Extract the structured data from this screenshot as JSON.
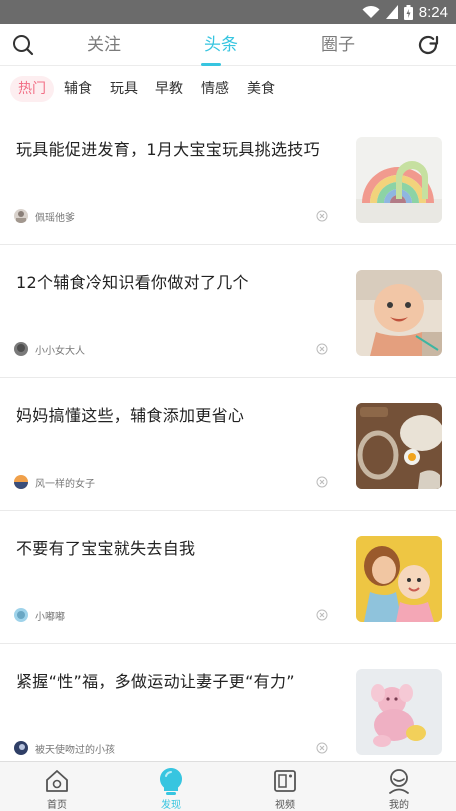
{
  "status": {
    "time": "8:24"
  },
  "header": {
    "tabs": [
      {
        "label": "关注"
      },
      {
        "label": "头条"
      },
      {
        "label": "圈子"
      }
    ],
    "active_tab": "头条",
    "accent": "#37c5e0"
  },
  "categories": [
    {
      "label": "热门"
    },
    {
      "label": "辅食"
    },
    {
      "label": "玩具"
    },
    {
      "label": "早教"
    },
    {
      "label": "情感"
    },
    {
      "label": "美食"
    }
  ],
  "active_category": "热门",
  "feed": [
    {
      "title": "玩具能促进发育，1月大宝宝玩具挑选技巧",
      "author": "佩瑶他爹"
    },
    {
      "title": "12个辅食冷知识看你做对了几个",
      "author": "小小女大人"
    },
    {
      "title": "妈妈搞懂这些，辅食添加更省心",
      "author": "风一样的女子"
    },
    {
      "title": "不要有了宝宝就失去自我",
      "author": "小嘟嘟"
    },
    {
      "title": "紧握“性”福，多做运动让妻子更“有力”",
      "author": "被天使吻过的小孩"
    }
  ],
  "bottom_nav": [
    {
      "label": "首页",
      "icon": "home-icon"
    },
    {
      "label": "发现",
      "icon": "bulb-icon"
    },
    {
      "label": "视频",
      "icon": "video-icon"
    },
    {
      "label": "我的",
      "icon": "user-icon"
    }
  ],
  "active_nav": "发现"
}
